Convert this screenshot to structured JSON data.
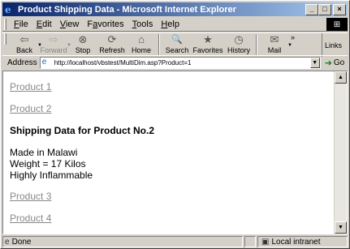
{
  "window": {
    "title": "Product Shipping Data - Microsoft Internet Explorer",
    "controls": {
      "minimize": "_",
      "maximize": "□",
      "close": "×"
    }
  },
  "menu": {
    "items": [
      {
        "accel": "F",
        "rest": "ile"
      },
      {
        "accel": "E",
        "rest": "dit"
      },
      {
        "accel": "V",
        "rest": "iew"
      },
      {
        "pre": "F",
        "accel": "a",
        "rest": "vorites"
      },
      {
        "accel": "T",
        "rest": "ools"
      },
      {
        "accel": "H",
        "rest": "elp"
      }
    ]
  },
  "toolbar": {
    "back": {
      "label": "Back",
      "icon": "back-arrow-icon",
      "glyph": "⇦"
    },
    "forward": {
      "label": "Forward",
      "icon": "forward-arrow-icon",
      "glyph": "⇨"
    },
    "stop": {
      "label": "Stop",
      "icon": "stop-icon",
      "glyph": "⊗"
    },
    "refresh": {
      "label": "Refresh",
      "icon": "refresh-icon",
      "glyph": "⟳"
    },
    "home": {
      "label": "Home",
      "icon": "home-icon",
      "glyph": "⌂"
    },
    "search": {
      "label": "Search",
      "icon": "search-icon",
      "glyph": "🔍"
    },
    "favorites": {
      "label": "Favorites",
      "icon": "favorites-icon",
      "glyph": "★"
    },
    "history": {
      "label": "History",
      "icon": "history-icon",
      "glyph": "◷"
    },
    "mail": {
      "label": "Mail",
      "icon": "mail-icon",
      "glyph": "✉"
    },
    "chevron": "»",
    "links": "Links"
  },
  "address": {
    "label": "Address",
    "url": "http://localhost/vbstest/MultiDim.asp?Product=1",
    "go_label": "Go"
  },
  "page": {
    "links": [
      "Product 1",
      "Product 2",
      "Product 3",
      "Product 4"
    ],
    "heading": "Shipping Data for Product No.2",
    "details": [
      "Made in Malawi",
      "Weight = 17 Kilos",
      "Highly Inflammable"
    ]
  },
  "status": {
    "text": "Done",
    "zone": "Local intranet"
  },
  "colors": {
    "titlebar_start": "#0a246a",
    "titlebar_end": "#a6caf0",
    "chrome": "#d4d0c8",
    "link_visited": "#888888"
  }
}
